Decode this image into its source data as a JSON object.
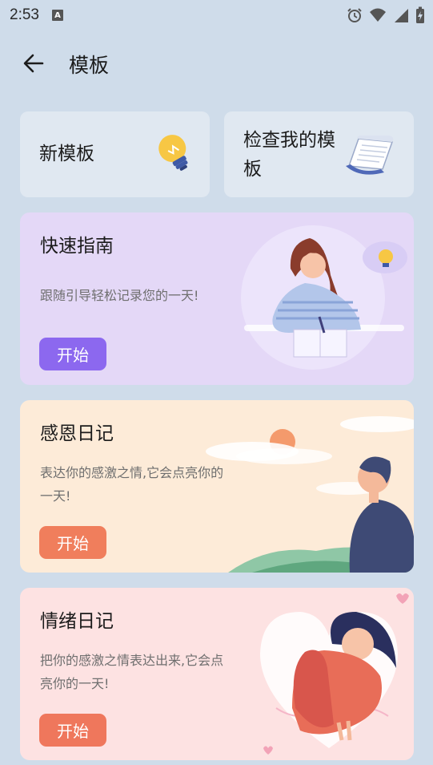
{
  "status_bar": {
    "time": "2:53",
    "notification_icon": "A"
  },
  "header": {
    "title": "模板",
    "back_icon": "arrow-left"
  },
  "quick_actions": [
    {
      "label": "新模板",
      "icon": "lightbulb-icon"
    },
    {
      "label_line1": "检查我的模",
      "label_line2": "板",
      "icon": "paper-scroll-icon"
    }
  ],
  "templates": [
    {
      "title": "快速指南",
      "description": "跟随引导轻松记录您的一天!",
      "button": "开始",
      "bg": "#e4d8f7",
      "button_color": "#8c68ef"
    },
    {
      "title": "感恩日记",
      "description_line1": "表达你的感激之情,它会点亮你的",
      "description_line2": "一天!",
      "button": "开始",
      "bg": "#fdebd8",
      "button_color": "#f07e5c"
    },
    {
      "title": "情绪日记",
      "description_line1": "把你的感激之情表达出来,它会点",
      "description_line2": "亮你的一天!",
      "button": "开始",
      "bg": "#fde2e2",
      "button_color": "#ef775c"
    }
  ]
}
